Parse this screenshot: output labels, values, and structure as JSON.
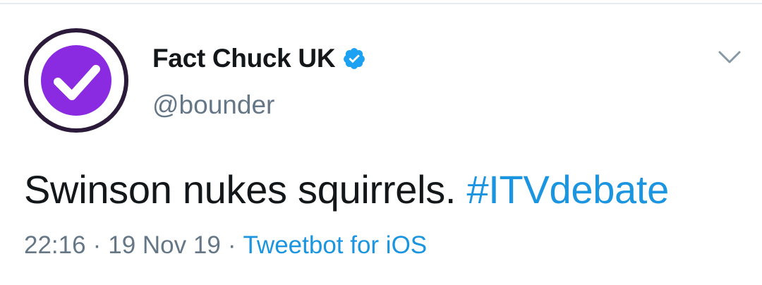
{
  "tweet": {
    "author": {
      "display_name": "Fact Chuck UK",
      "handle": "@bounder",
      "verified": true,
      "avatar_icon": "checkmark-icon",
      "avatar_color": "#8a2be2"
    },
    "text_main": "Swinson nukes squirrels. ",
    "hashtag": "#ITVdebate",
    "time": "22:16",
    "date": "19 Nov 19",
    "separator": "·",
    "source": "Tweetbot for iOS",
    "menu_icon": "chevron-down-icon"
  },
  "colors": {
    "link": "#1b95e0",
    "text": "#14171a",
    "secondary": "#657786",
    "verified_badge": "#1da1f2"
  }
}
